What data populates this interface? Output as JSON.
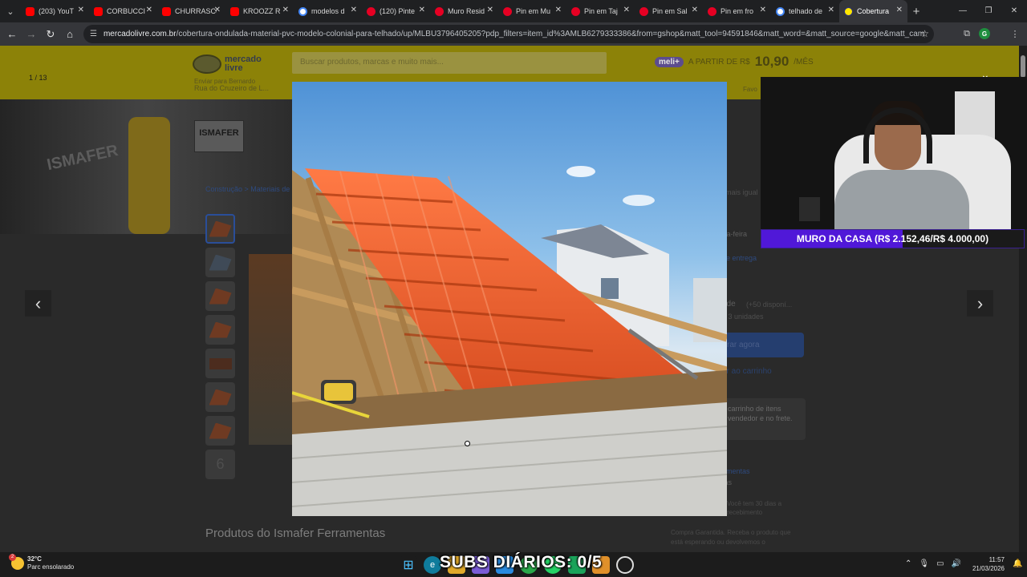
{
  "browser": {
    "tabs": [
      {
        "title": "(203) YouT",
        "icon": "youtube-icon",
        "kind": "yt"
      },
      {
        "title": "CORBUCCI",
        "icon": "youtube-icon",
        "kind": "yt"
      },
      {
        "title": "CHURRASCO",
        "icon": "youtube-icon",
        "kind": "yt"
      },
      {
        "title": "KROOZZ R",
        "icon": "youtube-icon",
        "kind": "yt"
      },
      {
        "title": "modelos d",
        "icon": "google-icon",
        "kind": "g"
      },
      {
        "title": "(120) Pinte",
        "icon": "pinterest-icon",
        "kind": "pin"
      },
      {
        "title": "Muro Resid",
        "icon": "pinterest-icon",
        "kind": "pin"
      },
      {
        "title": "Pin em Mu",
        "icon": "pinterest-icon",
        "kind": "pin"
      },
      {
        "title": "Pin em Taj",
        "icon": "pinterest-icon",
        "kind": "pin"
      },
      {
        "title": "Pin em Sal",
        "icon": "pinterest-icon",
        "kind": "pin"
      },
      {
        "title": "Pin em fro",
        "icon": "pinterest-icon",
        "kind": "pin"
      },
      {
        "title": "telhado de",
        "icon": "google-icon",
        "kind": "g"
      },
      {
        "title": "Cobertura",
        "icon": "mercadolivre-icon",
        "kind": "ml",
        "active": true
      }
    ],
    "new_tab": "+",
    "url_domain": "mercadolivre.com.br",
    "url_path": "/cobertura-ondulada-material-pvc-modelo-colonial-para-telhado/up/MLBU3796405205?pdp_filters=item_id%3AMLB6279333386&from=gshop&matt_tool=94591846&matt_word=&matt_source=google&matt_campaign_id=23...",
    "profile_letter": "G"
  },
  "page": {
    "counter": "1 / 13",
    "header": {
      "logo_line1": "mercado",
      "logo_line2": "livre",
      "search_placeholder": "Buscar produtos, marcas e muito mais...",
      "promo_badge": "meli+",
      "promo_text": "A PARTIR DE R$",
      "promo_price": "10,90",
      "promo_suffix": "/MÊS",
      "address_line1": "Enviar para Bernardo",
      "address_line2": "Rua do Cruzeiro de L...",
      "favorites": "Favo"
    },
    "banner": {
      "bg_word": "ISMAFER",
      "brand": "ISMAFER"
    },
    "breadcrumb": "Construção > Materiais de",
    "thumbs_more": "6",
    "right_panel": {
      "line1": "mais igual",
      "line2": "rta-feira",
      "line3": "de entrega",
      "line4": "ade",
      "line5": "(+50 disponí...",
      "line6": "e 3 unidades",
      "buy": "rar agora",
      "cart": "ar ao carrinho",
      "box": "carrinho de itens vendedor e no frete.",
      "seller": "amentas",
      "seller2": "tas",
      "return": "Você tem 30 dias a recebimento",
      "guarantee": "Compra Garantida. Receba o produto que está esperando ou devolvemos o"
    },
    "products_title": "Produtos do Ismafer Ferramentas"
  },
  "overlay": {
    "goal_text": "MURO DA CASA (R$ 2.152,46/R$ 4.000,00)",
    "goal_current": 2152.46,
    "goal_total": 4000.0,
    "goal_fraction": 0.538
  },
  "taskbar": {
    "weather_temp": "32°C",
    "weather_desc": "Parc ensolarado",
    "weather_badge": "2",
    "subs_text": "SUBS DIÁRIOS: 0/5",
    "time": "11:57",
    "date": "21/03/2026"
  }
}
